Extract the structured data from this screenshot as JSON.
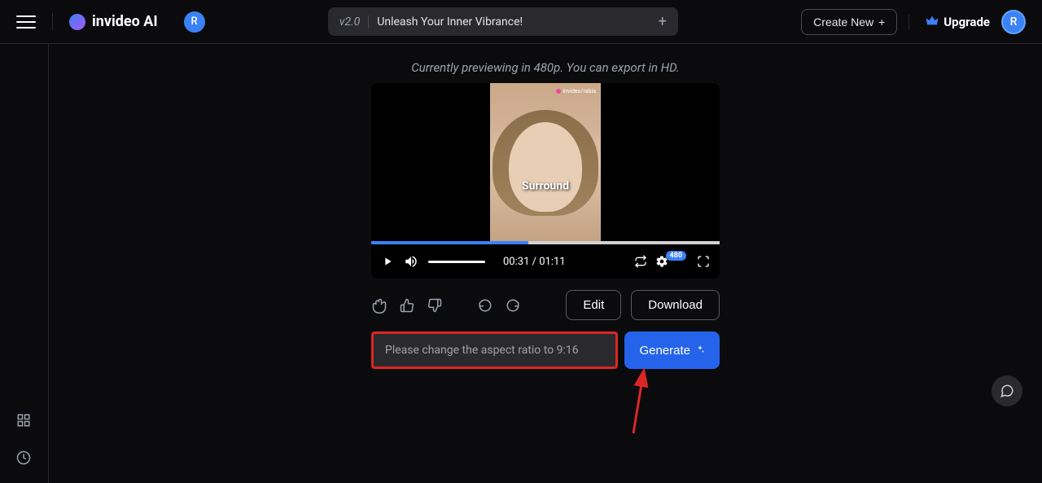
{
  "header": {
    "logo_text": "invideo AI",
    "avatar_initial": "R",
    "version": "v2.0",
    "title": "Unleash Your Inner Vibrance!",
    "create_new": "Create New",
    "upgrade": "Upgrade"
  },
  "preview": {
    "note": "Currently previewing in 480p. You can export in HD.",
    "caption": "Surround",
    "watermark": "invideo/rabia",
    "current_time": "00:31",
    "total_time": "01:11",
    "quality": "480"
  },
  "actions": {
    "edit": "Edit",
    "download": "Download"
  },
  "prompt": {
    "placeholder": "Please change the aspect ratio to 9:16",
    "generate": "Generate"
  }
}
